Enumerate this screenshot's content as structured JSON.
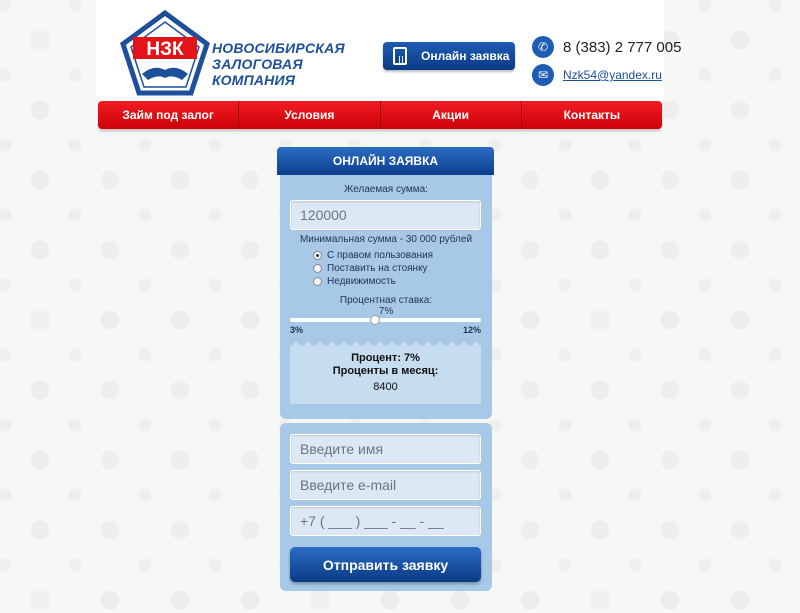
{
  "header": {
    "logo_text": "НЗК",
    "brand_line1": "Новосибирская",
    "brand_line2": "Залоговая компания",
    "online_button": "Онлайн заявка",
    "phone": "8 (383) 2 777 005",
    "email": "Nzk54@yandex.ru"
  },
  "nav": {
    "items": [
      "Займ под залог",
      "Условия",
      "Акции",
      "Контакты"
    ]
  },
  "form": {
    "title": "ОНЛАЙН ЗАЯВКА",
    "amount_label": "Желаемая сумма:",
    "amount_placeholder": "120000",
    "min_note": "Минимальная сумма - 30 000 рублей",
    "options": [
      {
        "label": "С правом пользования",
        "selected": true
      },
      {
        "label": "Поставить на стоянку",
        "selected": false
      },
      {
        "label": "Недвижимость",
        "selected": false
      }
    ],
    "rate_label": "Процентная ставка:",
    "rate_value": "7%",
    "rate_min": "3%",
    "rate_max": "12%",
    "rate_level_fraction": 0.444,
    "result_percent": "Процент: 7%",
    "result_monthly_label": "Проценты в месяц:",
    "result_monthly_value": "8400",
    "name_placeholder": "Введите имя",
    "email_placeholder": "Введите e-mail",
    "phone_placeholder": "+7 ( ___ ) ___ - __ - __",
    "submit_label": "Отправить заявку"
  },
  "colors": {
    "brand_blue": "#1d5db4",
    "nav_red": "#e3131a",
    "panel_blue": "#a7c9e7"
  }
}
